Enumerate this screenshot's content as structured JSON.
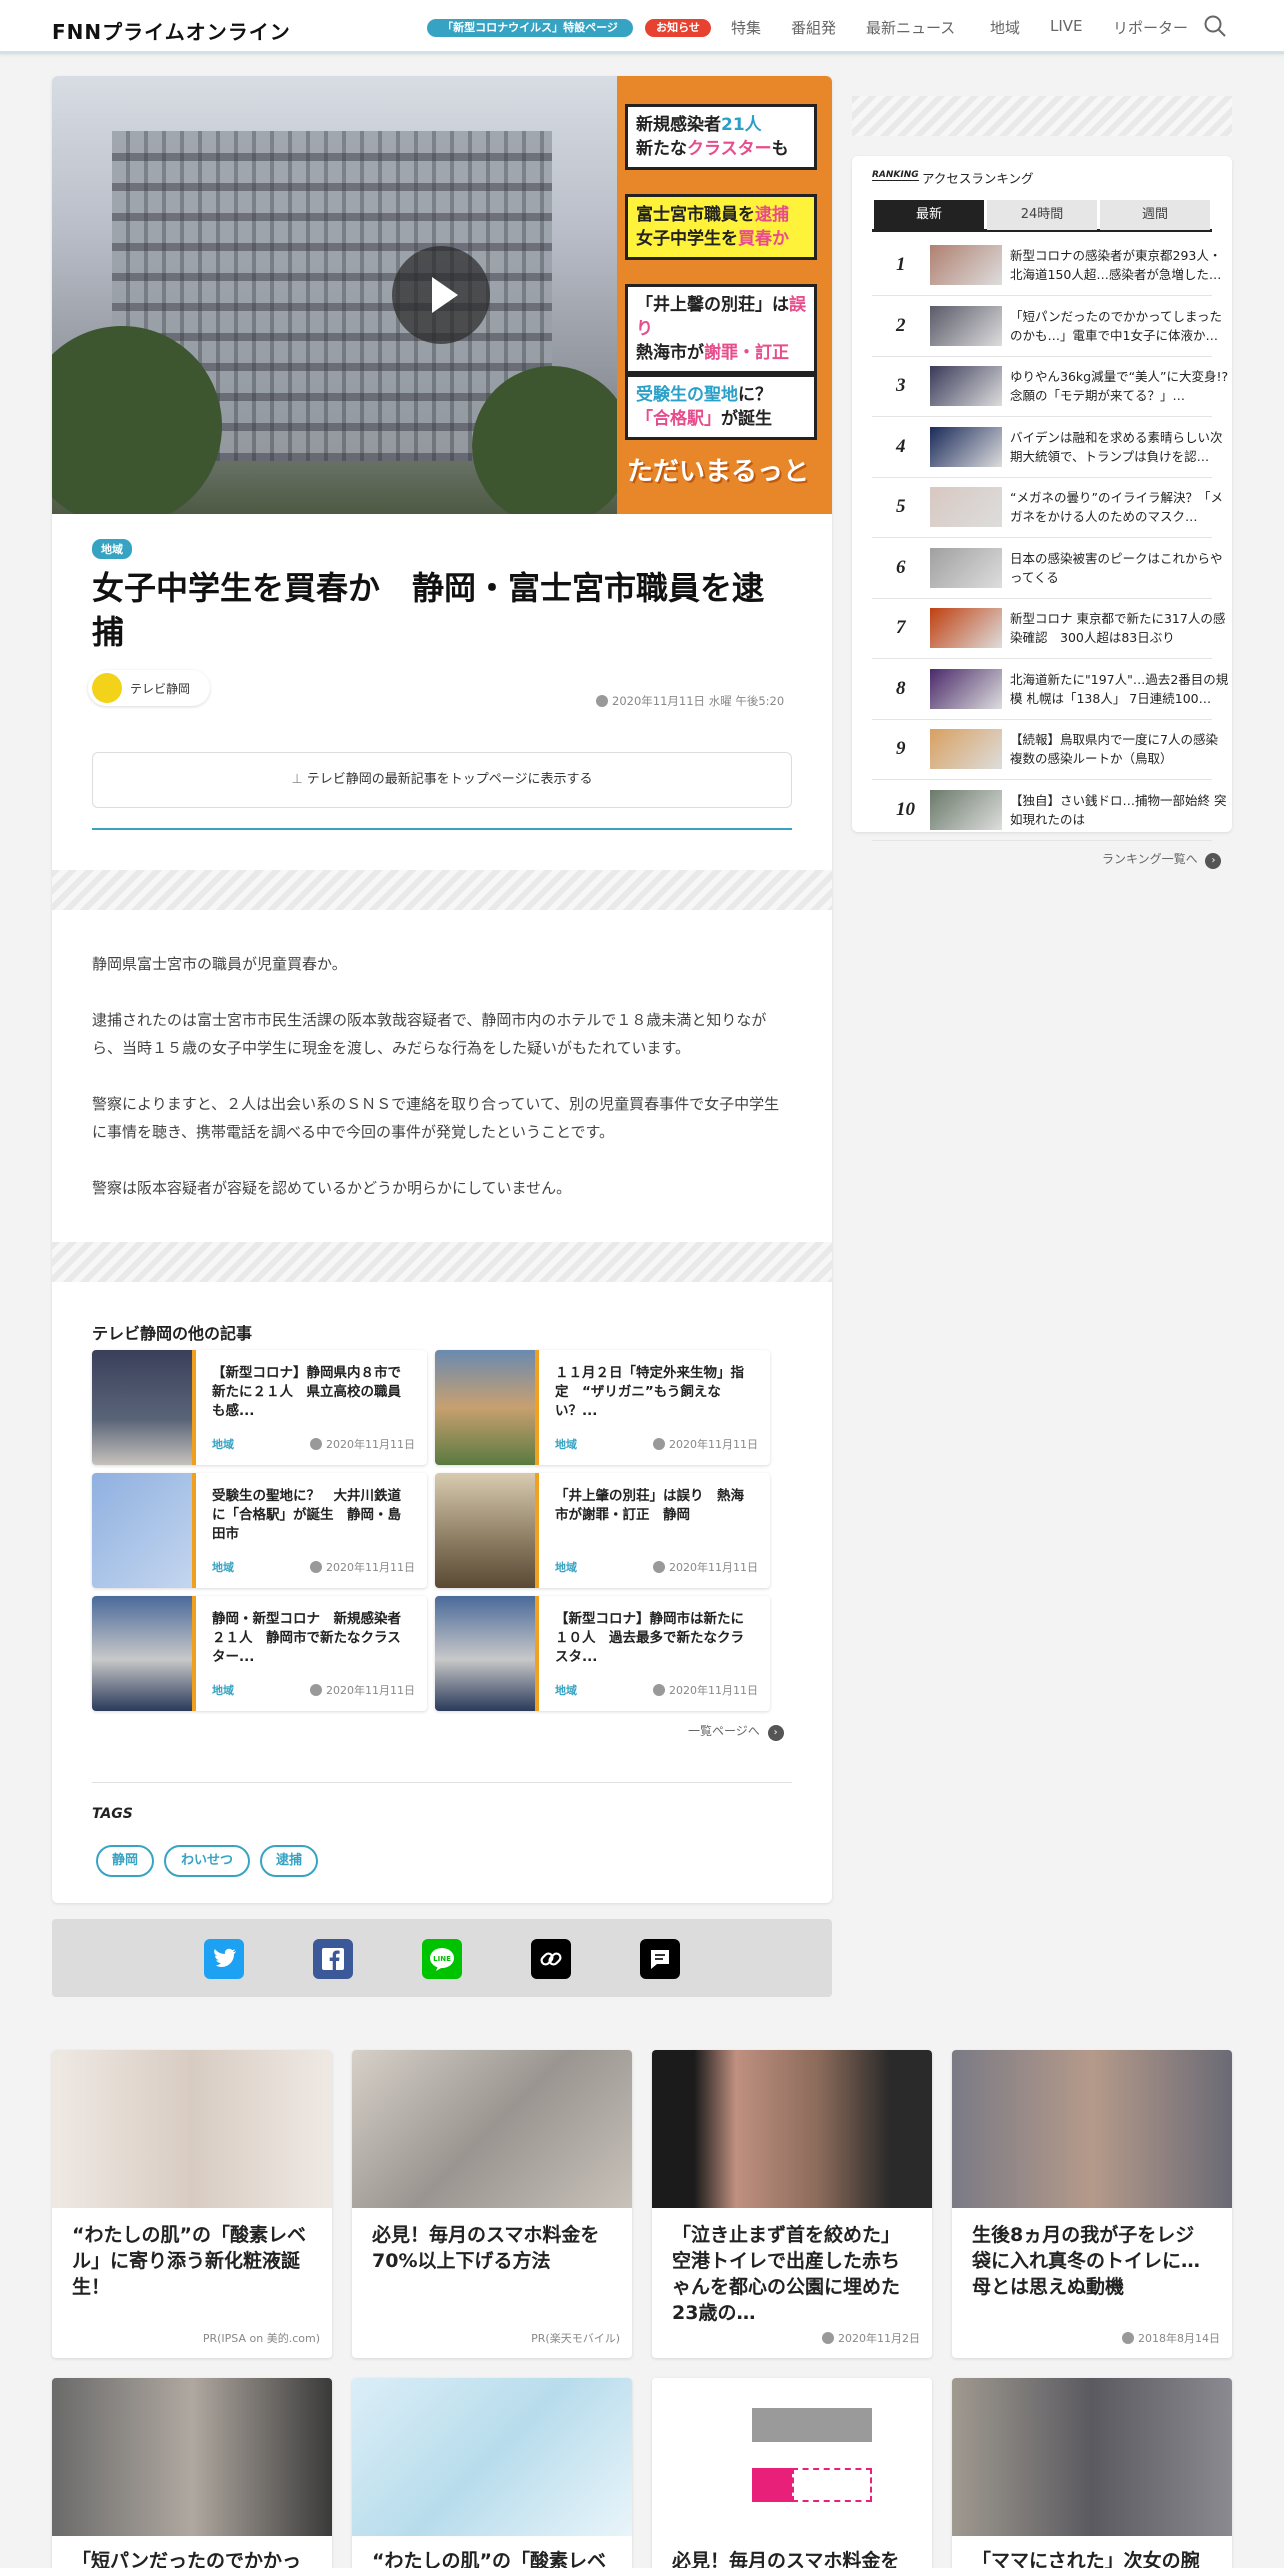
{
  "header": {
    "logo": "FNNプライムオンライン",
    "covid_pill": "「新型コロナウイルス」特設ページ",
    "notice_pill": "お知らせ",
    "nav": [
      "特集",
      "番組発",
      "最新ニュース",
      "地域",
      "LIVE",
      "リポーター"
    ]
  },
  "hero": {
    "captions": [
      {
        "a": "新規感染者",
        "b": "21人",
        "c": "新たな",
        "d": "クラスター",
        "e": "も"
      },
      {
        "a": "富士宮市職員",
        "b": "を",
        "c": "逮捕",
        "d": "女子中学生",
        "e": "を",
        "f": "買春か"
      },
      {
        "a": "「井上馨の別荘」",
        "b": "は",
        "c": "誤り",
        "d": "熱海市が",
        "e": "謝罪・訂正"
      },
      {
        "a": "受験生の聖地",
        "b": "に？",
        "c": "「合格駅」",
        "d": "が誕生"
      }
    ],
    "program": "ただいまるっと"
  },
  "article": {
    "category": "地域",
    "title": "女子中学生を買春か　静岡・富士宮市職員を逮捕",
    "source": "テレビ静岡",
    "date": "2020年11月11日 水曜 午後5:20",
    "pin_label": "テレビ静岡の最新記事をトップページに表示する",
    "paragraphs": [
      "静岡県富士宮市の職員が児童買春か。",
      "逮捕されたのは富士宮市市民生活課の阪本敦哉容疑者で、静岡市内のホテルで１８歳未満と知りながら、当時１５歳の女子中学生に現金を渡し、みだらな行為をした疑いがもたれています。",
      "警察によりますと、２人は出会い系のＳＮＳで連絡を取り合っていて、別の児童買春事件で女子中学生に事情を聴き、携帯電話を調べる中で今回の事件が発覚したということです。",
      "警察は阪本容疑者が容疑を認めているかどうか明らかにしていません。"
    ]
  },
  "related": {
    "heading": "テレビ静岡の他の記事",
    "items": [
      {
        "title": "【新型コロナ】静岡県内８市で新たに２１人　県立高校の職員も感...",
        "cat": "地域",
        "date": "2020年11月11日"
      },
      {
        "title": "１１月２日「特定外来生物」指定　“ザリガニ”もう飼えない？...",
        "cat": "地域",
        "date": "2020年11月11日"
      },
      {
        "title": "受験生の聖地に？　大井川鉄道に「合格駅」が誕生　静岡・島田市",
        "cat": "地域",
        "date": "2020年11月11日"
      },
      {
        "title": "「井上肇の別荘」は誤り　熱海市が謝罪・訂正　静岡",
        "cat": "地域",
        "date": "2020年11月11日"
      },
      {
        "title": "静岡・新型コロナ　新規感染者２１人　静岡市で新たなクラスター...",
        "cat": "地域",
        "date": "2020年11月11日"
      },
      {
        "title": "【新型コロナ】静岡市は新たに１０人　過去最多で新たなクラスタ...",
        "cat": "地域",
        "date": "2020年11月11日"
      }
    ],
    "more": "一覧ページへ"
  },
  "tags": {
    "heading": "TAGS",
    "items": [
      "静岡",
      "わいせつ",
      "逮捕"
    ]
  },
  "ranking": {
    "logo": "RANKING",
    "title": "アクセスランキング",
    "tabs": [
      "最新",
      "24時間",
      "週間"
    ],
    "items": [
      "新型コロナの感染者が東京都293人・北海道150人超…感染者が急増した…",
      "「短パンだったのでかかってしまったのかも…」電車で中1女子に体液か…",
      "ゆりやん36kg減量で“美人”に大変身!? 念願の「モテ期が来てる？」…",
      "バイデンは融和を求める素晴らしい次期大統領で、トランプは負けを認…",
      "“メガネの曇り”のイライラ解決？「メガネをかける人のためのマスク…",
      "日本の感染被害のピークはこれからやってくる",
      "新型コロナ 東京都で新たに317人の感染確認　300人超は83日ぶり",
      "北海道新たに\"197人\"…過去2番目の規模 札幌は「138人」 7日連続100…",
      "【続報】鳥取県内で一度に7人の感染　複数の感染ルートか（鳥取）",
      "【独自】さい銭ドロ…捕物一部始終 突如現れたのは"
    ],
    "more": "ランキング一覧へ"
  },
  "bottom": {
    "row1": [
      {
        "title": "“わたしの肌”の「酸素レベル」に寄り添う新化粧液誕生！",
        "meta": "PR(IPSA on 美的.com)"
      },
      {
        "title": "必見！毎月のスマホ料金を70%以上下げる方法",
        "meta": "PR(楽天モバイル)"
      },
      {
        "title": "「泣き止まず首を絞めた」空港トイレで出産した赤ちゃんを都心の公園に埋めた23歳の…",
        "meta": "2020年11月2日"
      },
      {
        "title": "生後8ヵ月の我が子をレジ袋に入れ真冬のトイレに…母とは思えぬ動機",
        "meta": "2018年8月14日"
      }
    ],
    "row2": [
      {
        "title": "「短パンだったのでかかっ"
      },
      {
        "title": "“わたしの肌”の「酸素レベ"
      },
      {
        "title": "必見！毎月のスマホ料金を"
      },
      {
        "title": "「ママにされた」次女の腕"
      }
    ]
  },
  "colors": {
    "accent": "#37a3c3",
    "notice": "#e7422f"
  }
}
